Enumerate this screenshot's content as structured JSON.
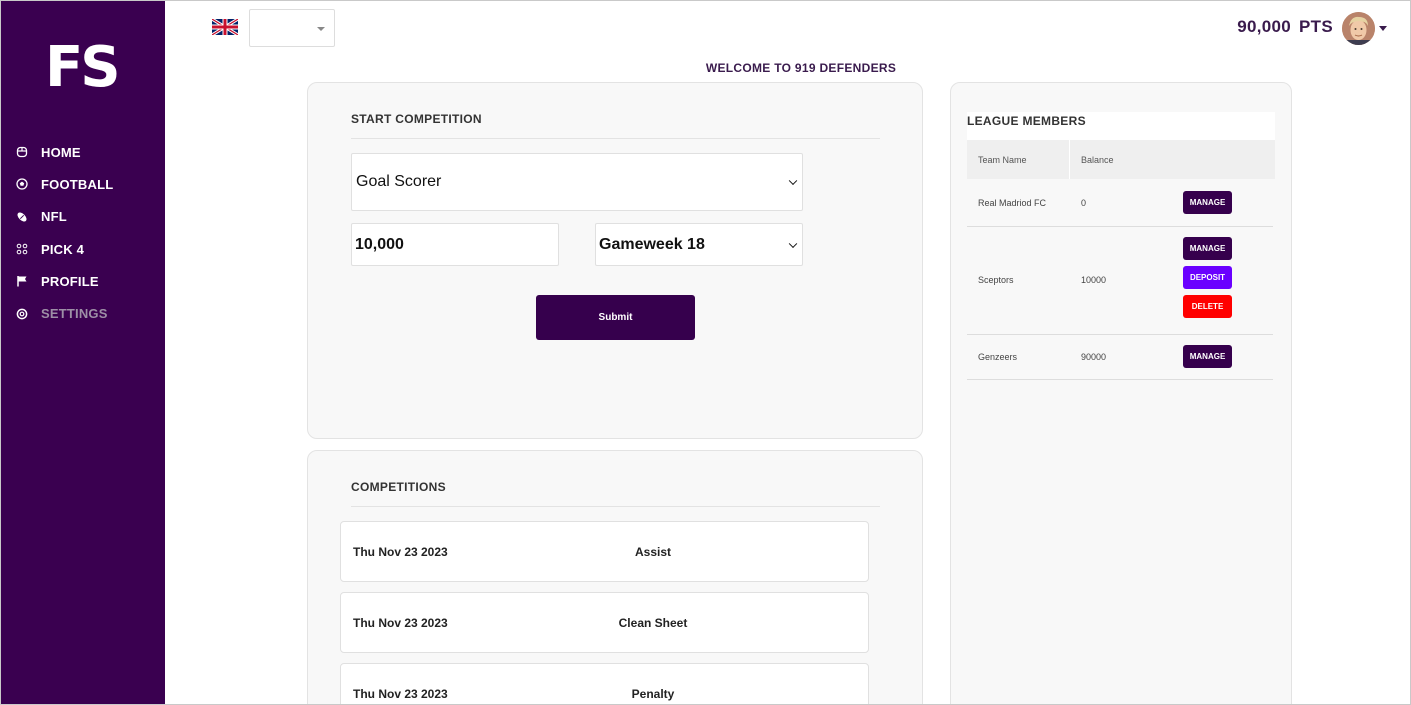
{
  "sidebar": {
    "logo": "FS",
    "items": [
      {
        "label": "HOME",
        "icon": "home-icon"
      },
      {
        "label": "FOOTBALL",
        "icon": "soccer-ball-icon"
      },
      {
        "label": "NFL",
        "icon": "american-football-icon"
      },
      {
        "label": "PICK 4",
        "icon": "grid-dots-icon"
      },
      {
        "label": "PROFILE",
        "icon": "flag-icon"
      },
      {
        "label": "SETTINGS",
        "icon": "gear-icon"
      }
    ]
  },
  "header": {
    "language_flag": "uk-flag-icon",
    "language_value": "",
    "points_value": "90,000",
    "points_unit": "PTS"
  },
  "welcome": "WELCOME TO 919 DEFENDERS",
  "start_competition": {
    "title": "START COMPETITION",
    "type_value": "Goal Scorer",
    "amount_value": "10,000",
    "gameweek_value": "Gameweek 18",
    "submit_label": "Submit"
  },
  "competitions": {
    "title": "COMPETITIONS",
    "rows": [
      {
        "date": "Thu Nov 23 2023",
        "type": "Assist"
      },
      {
        "date": "Thu Nov 23 2023",
        "type": "Clean Sheet"
      },
      {
        "date": "Thu Nov 23 2023",
        "type": "Penalty"
      }
    ]
  },
  "league_members": {
    "title": "LEAGUE MEMBERS",
    "columns": [
      "Team Name",
      "Balance"
    ],
    "rows": [
      {
        "team": "Real Madriod FC",
        "balance": "0",
        "actions": [
          "MANAGE"
        ]
      },
      {
        "team": "Sceptors",
        "balance": "10000",
        "actions": [
          "MANAGE",
          "DEPOSIT",
          "DELETE"
        ]
      },
      {
        "team": "Genzeers",
        "balance": "90000",
        "actions": [
          "MANAGE"
        ]
      }
    ]
  },
  "colors": {
    "sidebar": "#3a0050",
    "primary_button": "#36004d",
    "deposit": "#6a00ff",
    "delete": "#ff0000",
    "accent_text": "#3a1b4d"
  }
}
